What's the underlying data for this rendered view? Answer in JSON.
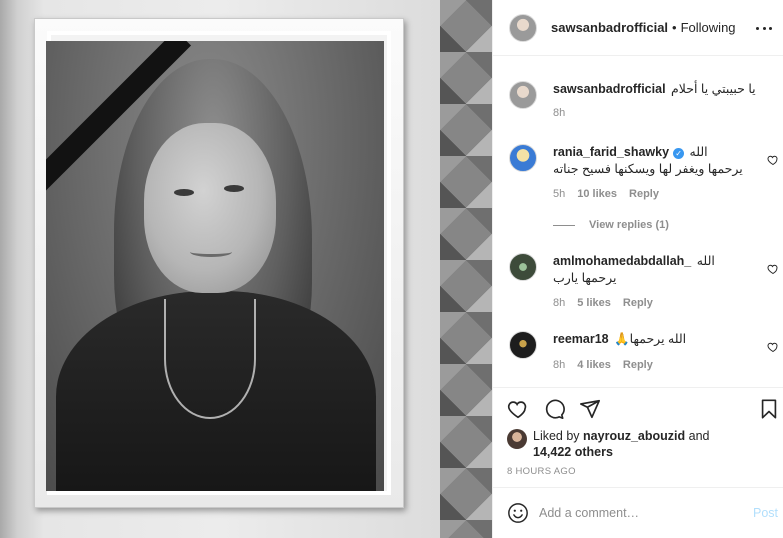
{
  "post": {
    "username": "sawsanbadrofficial",
    "separator": "•",
    "follow_status": "Following",
    "caption": {
      "author": "sawsanbadrofficial",
      "text": "يا حبيبتي يا أحلام",
      "time": "8h"
    }
  },
  "comments": [
    {
      "author": "rania_farid_shawky",
      "verified": true,
      "text": "الله يرحمها ويغفر لها ويسكنها فسيح جناته",
      "time": "5h",
      "likes": "10 likes",
      "reply": "Reply",
      "view_replies": "View replies (1)"
    },
    {
      "author": "amlmohamedabdallah_",
      "text": "الله يرحمها يارب",
      "time": "8h",
      "likes": "5 likes",
      "reply": "Reply"
    },
    {
      "author": "reemar18",
      "text": "الله يرحمها🙏",
      "time": "8h",
      "likes": "4 likes",
      "reply": "Reply"
    }
  ],
  "likes": {
    "prefix": "Liked by",
    "user": "nayrouz_abouzid",
    "connector": "and",
    "others": "14,422 others"
  },
  "timestamp": "8 HOURS AGO",
  "add_comment": {
    "placeholder": "Add a comment…",
    "post_label": "Post"
  },
  "icons": {
    "verified": "verified-badge-icon",
    "heart": "heart-icon",
    "comment": "comment-icon",
    "share": "share-icon",
    "save": "bookmark-icon",
    "emoji": "emoji-icon",
    "more": "more-icon"
  },
  "colors": {
    "link_blue": "#3897f0",
    "post_disabled": "#b2dffc",
    "secondary_text": "#8e8e8e"
  }
}
